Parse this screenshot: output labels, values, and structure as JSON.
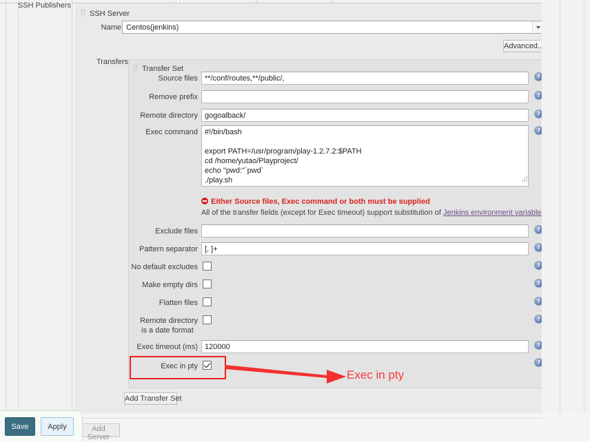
{
  "left_column": {
    "label": "SSH Publishers"
  },
  "server_panel": {
    "title": "SSH Server",
    "name_label": "Name",
    "name_value": "Centos(jenkins)",
    "advanced_button": "Advanced...",
    "transfers_label": "Transfers"
  },
  "transfer_set": {
    "title": "Transfer Set",
    "fields": {
      "source_files": {
        "label": "Source files",
        "value": "**/conf/routes,**/public/,"
      },
      "remove_prefix": {
        "label": "Remove prefix",
        "value": ""
      },
      "remote_directory": {
        "label": "Remote directory",
        "value": "gogoalback/"
      },
      "exec_command": {
        "label": "Exec command",
        "value": "#!/bin/bash\n\nexport PATH=/usr/program/play-1.2.7.2:$PATH\ncd /home/yutao/Playproject/\necho \"pwd:\"`pwd`\n./play.sh"
      },
      "exclude_files": {
        "label": "Exclude files",
        "value": ""
      },
      "pattern_separator": {
        "label": "Pattern separator",
        "value": "[, ]+"
      },
      "no_default_excludes": {
        "label": "No default excludes",
        "checked": false
      },
      "make_empty_dirs": {
        "label": "Make empty dirs",
        "checked": false
      },
      "flatten_files": {
        "label": "Flatten files",
        "checked": false
      },
      "remote_dir_is_date_format": {
        "label_line1": "Remote directory",
        "label_line2": "is a date format",
        "checked": false
      },
      "exec_timeout": {
        "label": "Exec timeout (ms)",
        "value": "120000"
      },
      "exec_in_pty": {
        "label": "Exec in pty",
        "checked": true
      }
    },
    "error_message": "Either Source files, Exec command or both must be supplied",
    "help_text_prefix": "All of the transfer fields (except for Exec timeout) support substitution of ",
    "help_link": "Jenkins environment variables",
    "add_transfer_set_button": "Add Transfer Set"
  },
  "annotation": {
    "callout_text": "Exec in pty",
    "color": "#f83a3a"
  },
  "footer": {
    "save_button": "Save",
    "apply_button": "Apply",
    "add_server_button": "Add Server"
  },
  "icons": {
    "help": "?"
  }
}
